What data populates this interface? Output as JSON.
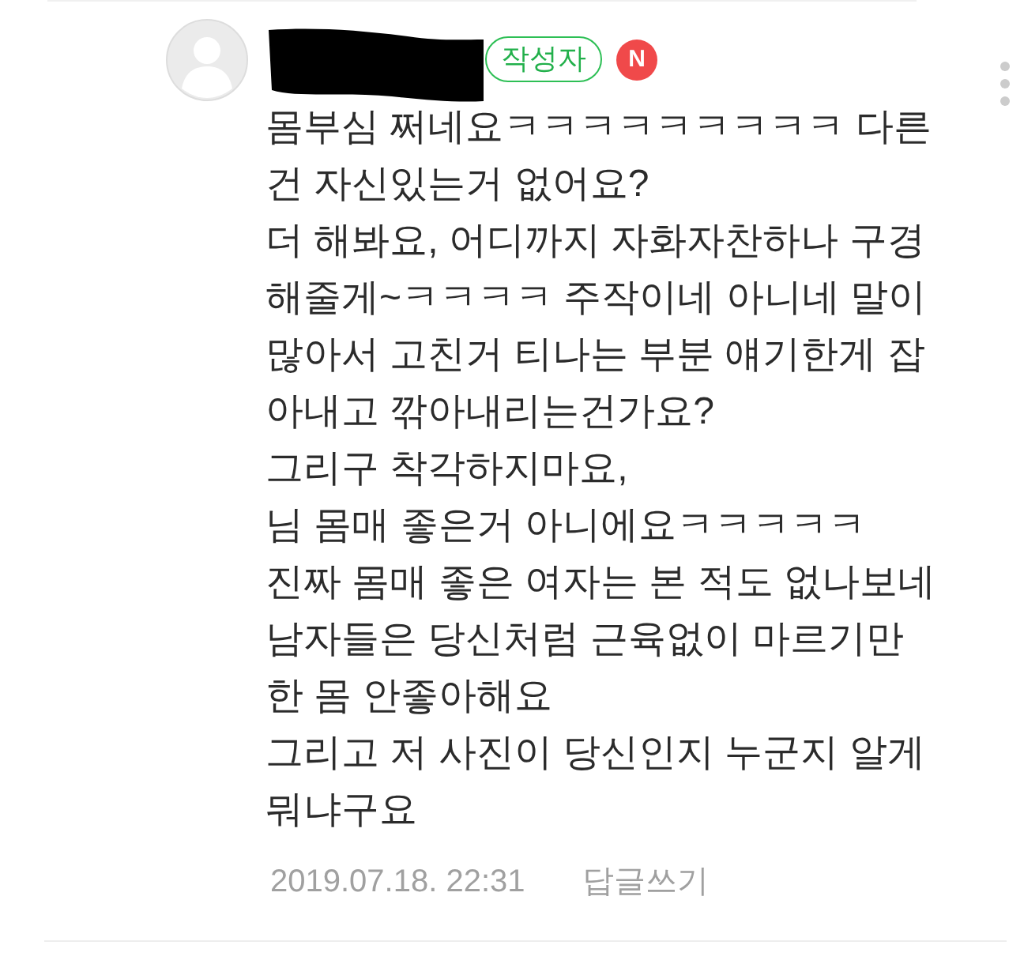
{
  "comment": {
    "author_badge": "작성자",
    "new_badge": "N",
    "body_lines": [
      "몸부심 쩌네요ㅋㅋㅋㅋㅋㅋㅋㅋㅋ 다른",
      "건 자신있는거 없어요?",
      "더 해봐요, 어디까지 자화자찬하나 구경",
      "해줄게~ㅋㅋㅋㅋ 주작이네 아니네 말이",
      "많아서 고친거 티나는 부분 얘기한게 잡",
      "아내고 깎아내리는건가요?",
      "그리구 착각하지마요,",
      "님 몸매 좋은거 아니에요ㅋㅋㅋㅋㅋ",
      "진짜 몸매 좋은 여자는 본 적도 없나보네",
      "남자들은 당신처럼 근육없이 마르기만",
      "한 몸 안좋아해요",
      "그리고 저 사진이 당신인지 누군지 알게",
      "뭐냐구요"
    ],
    "date": "2019.07.18. 22:31",
    "reply_link": "답글쓰기"
  }
}
